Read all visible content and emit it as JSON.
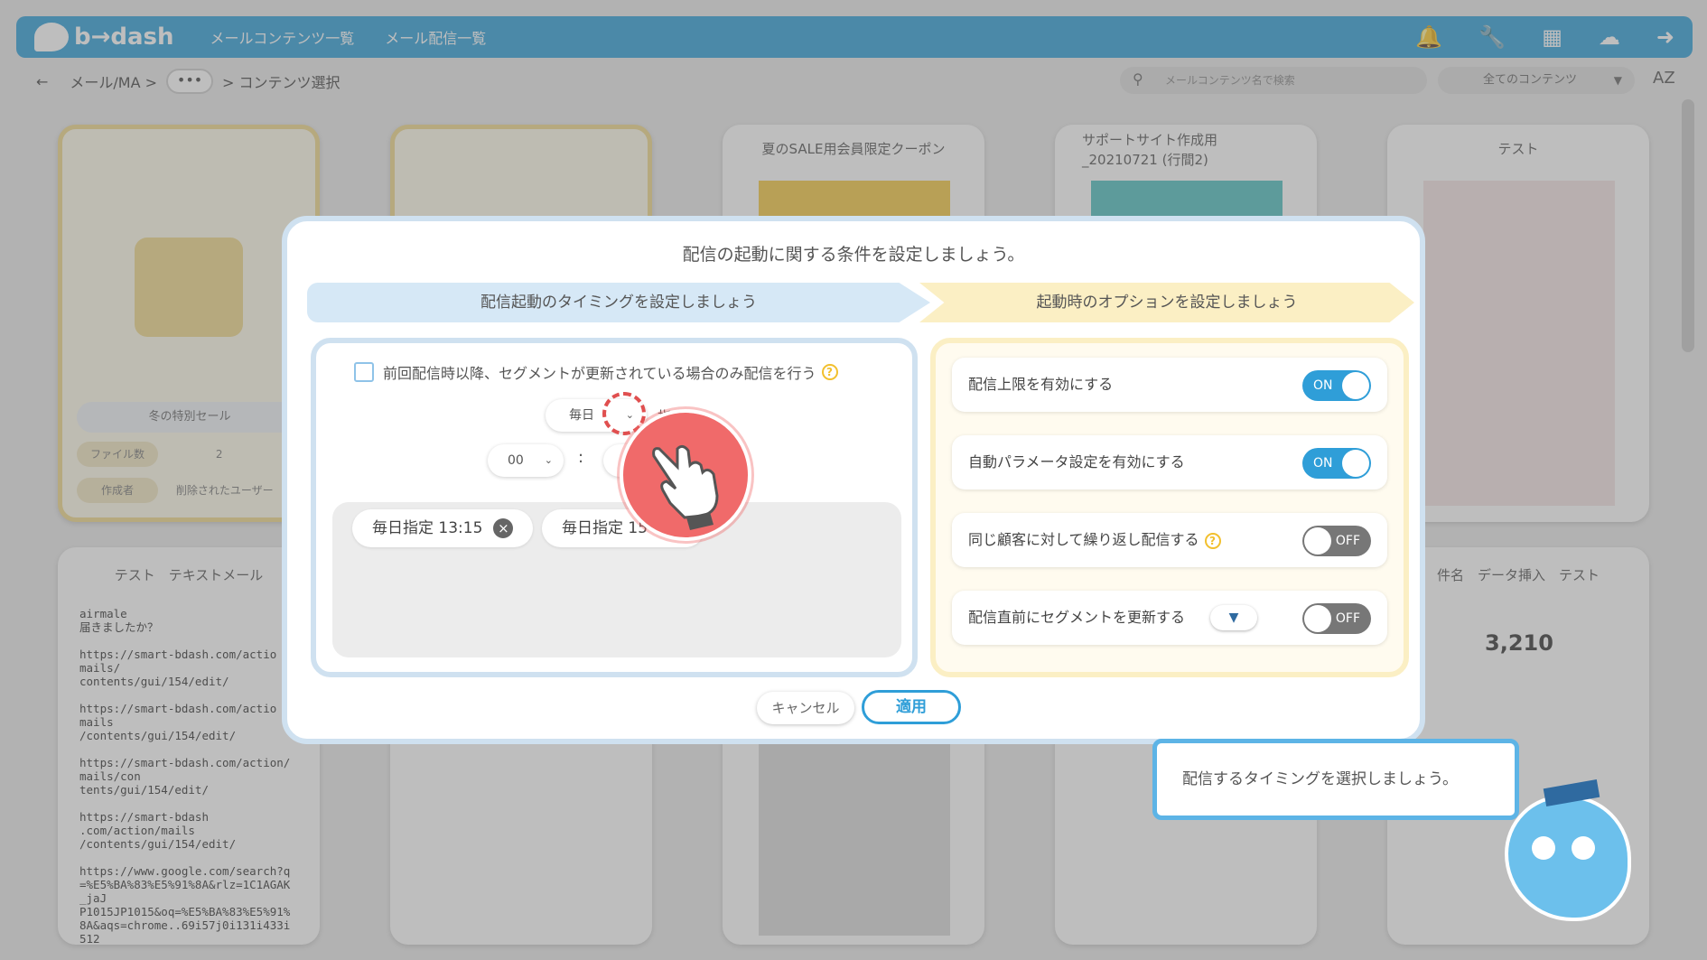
{
  "header": {
    "logo": "b→dash",
    "nav": [
      "メールコンテンツ一覧",
      "メール配信一覧"
    ],
    "icons": [
      "bell-icon",
      "wrench-icon",
      "grid-icon",
      "cloud-icon",
      "logout-icon"
    ]
  },
  "breadcrumb": {
    "back": "←",
    "root": "メール/MA >",
    "ellipsis": "•••",
    "current": "> コンテンツ選択"
  },
  "search": {
    "placeholder": "メールコンテンツ名で検索"
  },
  "filter": {
    "selected": "全てのコンテンツ"
  },
  "sort_label": "AZ",
  "background_cards": {
    "folder": {
      "title": "冬の特別セール",
      "file_count_label": "ファイル数",
      "file_count": "2",
      "author_label": "作成者",
      "author": "削除されたユーザー"
    },
    "coupon_title": "夏のSALE用会員限定クーポン",
    "support_title": "サポートサイト作成用_20210721 (行間2)",
    "test_title": "テスト",
    "text_mail_title": "テスト　テキストメール",
    "insert_title": "件名　データ挿入　テスト",
    "text_mail_body": "airmale\n届きましたか？\n\nhttps://smart-bdash.com/actio\nmails/\ncontents/gui/154/edit/\n\nhttps://smart-bdash.com/actio\nmails\n/contents/gui/154/edit/\n\nhttps://smart-bdash.com/action/\nmails/con\ntents/gui/154/edit/\n\nhttps://smart-bdash\n.com/action/mails\n/contents/gui/154/edit/\n\nhttps://www.google.com/search?q\n=%E5%BA%83%E5%91%8A&rlz=1C1AGAK\n_jaJ\nP1015JP1015&oq=%E5%BA%83%E5%91%\n8A&aqs=chrome..69i57j0i131i433i\n512",
    "points_value": "3,210"
  },
  "modal": {
    "title": "配信の起動に関する条件を設定しましょう。",
    "step1": "配信起動のタイミングを設定しましょう",
    "step2": "起動時のオプションを設定しましょう",
    "checkbox_label": "前回配信時以降、セグメントが更新されている場合のみ配信を行う",
    "frequency": "毎日",
    "frequency_suffix": "指定",
    "hour": "00",
    "colon": ":",
    "minute": "00",
    "tags": [
      "毎日指定 13:15",
      "毎日指定 15"
    ],
    "options": [
      {
        "label": "配信上限を有効にする",
        "state": "ON"
      },
      {
        "label": "自動パラメータ設定を有効にする",
        "state": "ON"
      },
      {
        "label": "同じ顧客に対して繰り返し配信する",
        "state": "OFF"
      },
      {
        "label": "配信直前にセグメントを更新する",
        "state": "OFF"
      }
    ],
    "cancel": "キャンセル",
    "apply": "適用"
  },
  "tooltip": {
    "text": "配信するタイミングを選択しましょう。"
  },
  "colors": {
    "accent": "#2f9ed8",
    "step1": "#d6e8f6",
    "step2": "#fbefc4",
    "pointer": "#f06a6a"
  }
}
